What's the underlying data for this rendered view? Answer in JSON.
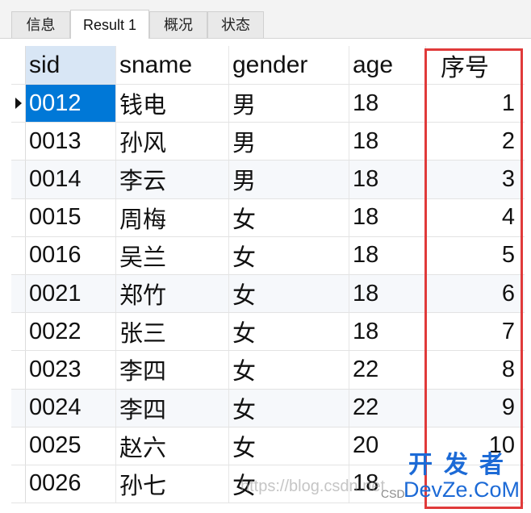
{
  "tabs": [
    {
      "label": "信息"
    },
    {
      "label": "Result 1"
    },
    {
      "label": "概况"
    },
    {
      "label": "状态"
    }
  ],
  "active_tab": "Result 1",
  "columns": [
    "sid",
    "sname",
    "gender",
    "age",
    "序号"
  ],
  "rows": [
    {
      "sid": "0012",
      "sname": "钱电",
      "gender": "男",
      "age": "18",
      "seq": "1"
    },
    {
      "sid": "0013",
      "sname": "孙风",
      "gender": "男",
      "age": "18",
      "seq": "2"
    },
    {
      "sid": "0014",
      "sname": "李云",
      "gender": "男",
      "age": "18",
      "seq": "3"
    },
    {
      "sid": "0015",
      "sname": "周梅",
      "gender": "女",
      "age": "18",
      "seq": "4"
    },
    {
      "sid": "0016",
      "sname": "吴兰",
      "gender": "女",
      "age": "18",
      "seq": "5"
    },
    {
      "sid": "0021",
      "sname": "郑竹",
      "gender": "女",
      "age": "18",
      "seq": "6"
    },
    {
      "sid": "0022",
      "sname": "张三",
      "gender": "女",
      "age": "18",
      "seq": "7"
    },
    {
      "sid": "0023",
      "sname": "李四",
      "gender": "女",
      "age": "22",
      "seq": "8"
    },
    {
      "sid": "0024",
      "sname": "李四",
      "gender": "女",
      "age": "22",
      "seq": "9"
    },
    {
      "sid": "0025",
      "sname": "赵六",
      "gender": "女",
      "age": "20",
      "seq": "10"
    },
    {
      "sid": "0026",
      "sname": "孙七",
      "gender": "女",
      "age": "18",
      "seq": ""
    }
  ],
  "selected_row": 0,
  "watermark": {
    "url": "https://blog.csdn.net",
    "csd": "CSD",
    "logo_cn": "开发者",
    "logo_en": "DevZe.CoM"
  },
  "colors": {
    "selection": "#0078d7",
    "highlight_box": "#e03a3a",
    "logo": "#1c6ad6"
  },
  "icons": {
    "row_marker": "current-row-arrow-icon"
  }
}
